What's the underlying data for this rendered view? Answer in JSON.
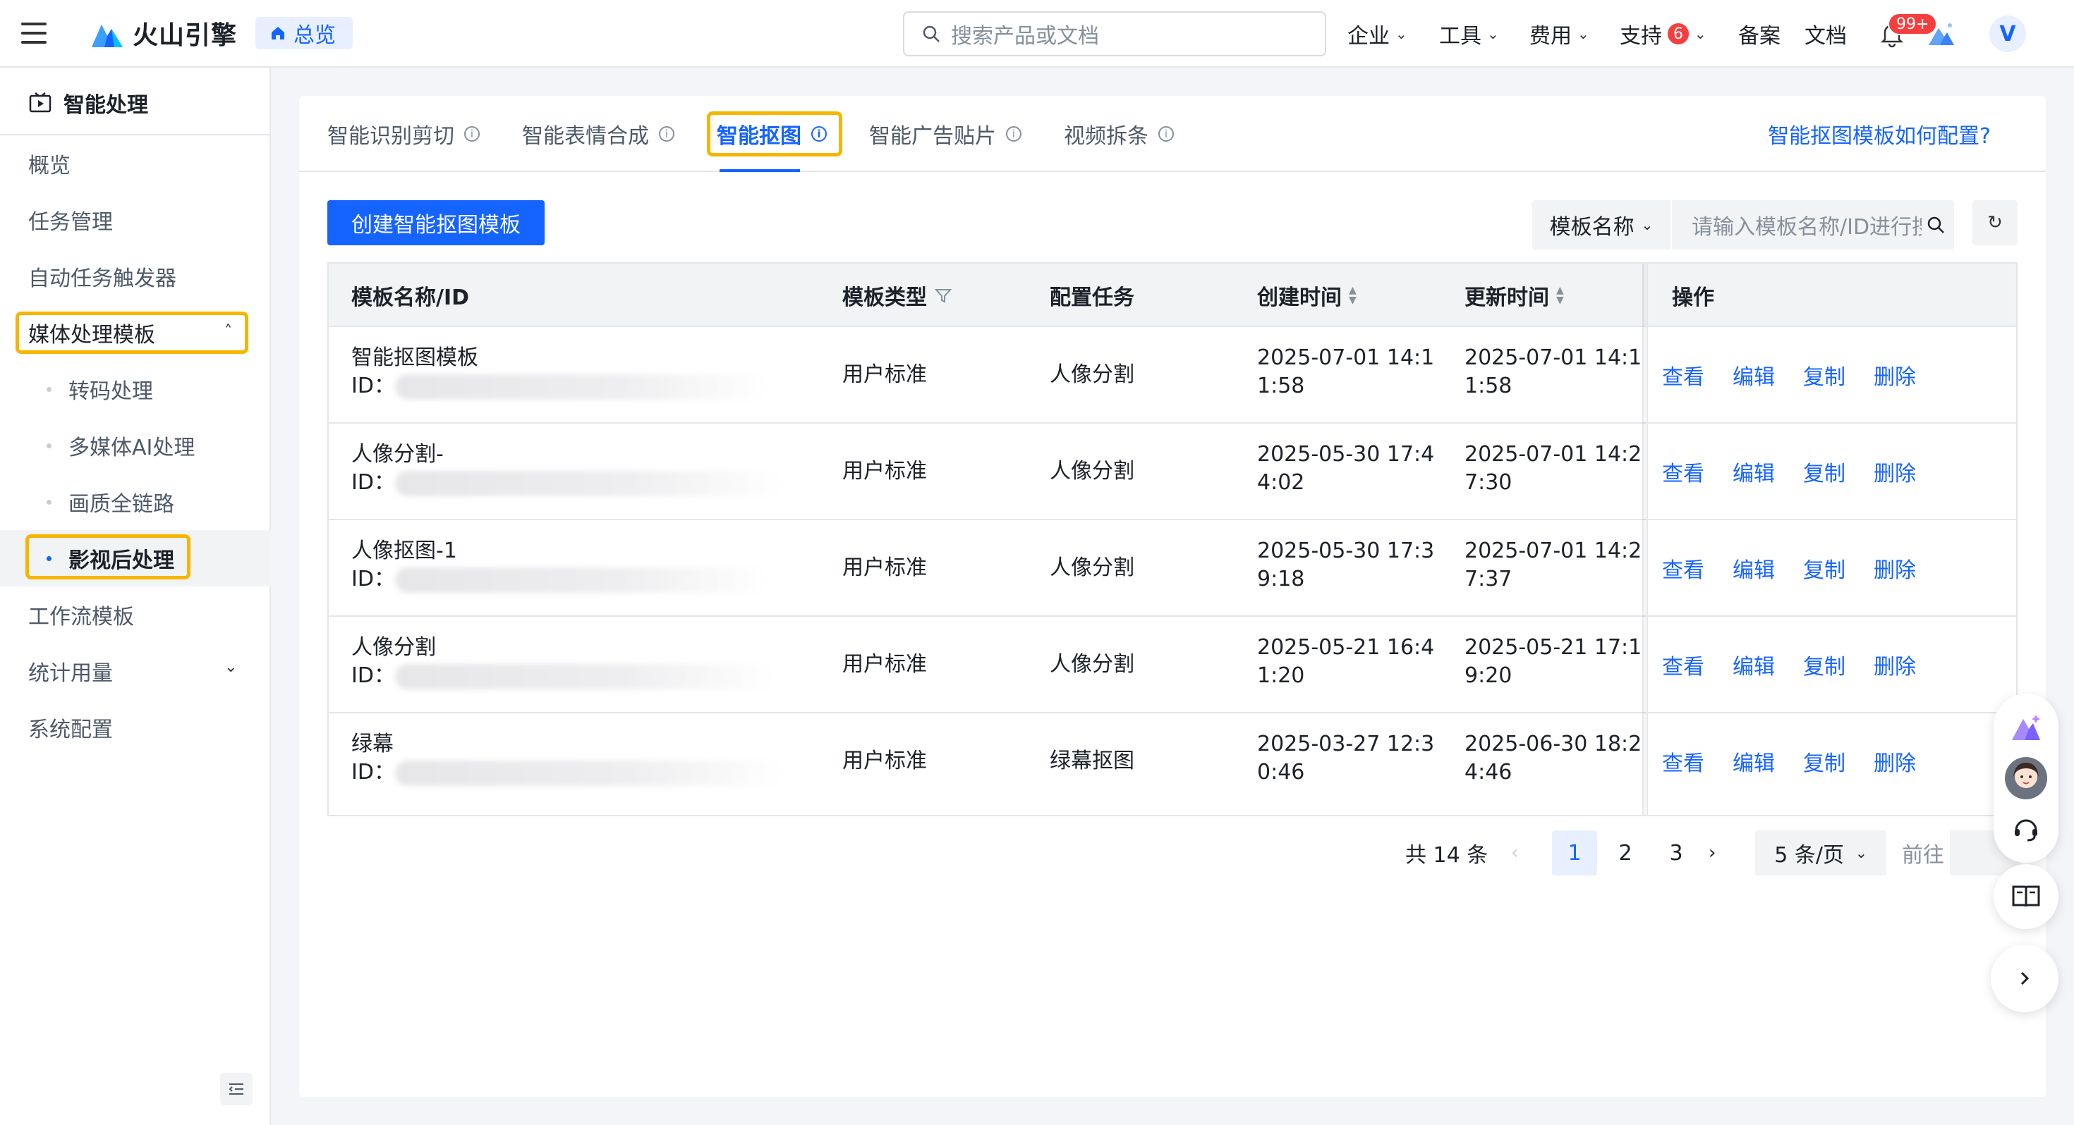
{
  "header": {
    "logo_text": "火山引擎",
    "overview_label": "总览",
    "search_placeholder": "搜索产品或文档",
    "nav": [
      {
        "label": "企业"
      },
      {
        "label": "工具"
      },
      {
        "label": "费用"
      },
      {
        "label": "支持",
        "badge": "6"
      },
      {
        "label": "备案"
      },
      {
        "label": "文档"
      }
    ],
    "notification_badge": "99+",
    "avatar_letter": "V"
  },
  "sidebar": {
    "title": "智能处理",
    "items": [
      {
        "label": "概览"
      },
      {
        "label": "任务管理"
      },
      {
        "label": "自动任务触发器"
      },
      {
        "label": "媒体处理模板"
      },
      {
        "label": "工作流模板"
      },
      {
        "label": "统计用量"
      },
      {
        "label": "系统配置"
      }
    ],
    "sub_items": [
      {
        "label": "转码处理"
      },
      {
        "label": "多媒体AI处理"
      },
      {
        "label": "画质全链路"
      },
      {
        "label": "影视后处理"
      }
    ]
  },
  "tabs": [
    {
      "label": "智能识别剪切"
    },
    {
      "label": "智能表情合成"
    },
    {
      "label": "智能抠图"
    },
    {
      "label": "智能广告贴片"
    },
    {
      "label": "视频拆条"
    }
  ],
  "help_link": "智能抠图模板如何配置?",
  "toolbar": {
    "create_label": "创建智能抠图模板",
    "filter_field": "模板名称",
    "filter_placeholder": "请输入模板名称/ID进行搜索"
  },
  "table": {
    "columns": [
      "模板名称/ID",
      "模板类型",
      "配置任务",
      "创建时间",
      "更新时间",
      "操作"
    ],
    "rows": [
      {
        "name": "智能抠图模板",
        "id_label": "ID：",
        "type": "用户标准",
        "task": "人像分割",
        "created_1": "2025-07-01 14:1",
        "created_2": "1:58",
        "updated_1": "2025-07-01 14:1",
        "updated_2": "1:58"
      },
      {
        "name": "人像分割-",
        "id_label": "ID：",
        "type": "用户标准",
        "task": "人像分割",
        "created_1": "2025-05-30 17:4",
        "created_2": "4:02",
        "updated_1": "2025-07-01 14:2",
        "updated_2": "7:30"
      },
      {
        "name": "人像抠图-1",
        "id_label": "ID：",
        "type": "用户标准",
        "task": "人像分割",
        "created_1": "2025-05-30 17:3",
        "created_2": "9:18",
        "updated_1": "2025-07-01 14:2",
        "updated_2": "7:37"
      },
      {
        "name": "人像分割",
        "id_label": "ID：",
        "type": "用户标准",
        "task": "人像分割",
        "created_1": "2025-05-21 16:4",
        "created_2": "1:20",
        "updated_1": "2025-05-21 17:1",
        "updated_2": "9:20"
      },
      {
        "name": "绿幕",
        "id_label": "ID：",
        "type": "用户标准",
        "task": "绿幕抠图",
        "created_1": "2025-03-27 12:3",
        "created_2": "0:46",
        "updated_1": "2025-06-30 18:2",
        "updated_2": "4:46"
      }
    ],
    "actions": [
      "查看",
      "编辑",
      "复制",
      "删除"
    ]
  },
  "pagination": {
    "total_text": "共 14 条",
    "pages": [
      "1",
      "2",
      "3"
    ],
    "current_page": "1",
    "page_size": "5 条/页",
    "goto_label": "前往"
  },
  "colors": {
    "primary": "#1664ff",
    "highlight": "#f7b500",
    "danger": "#f53f3f"
  }
}
